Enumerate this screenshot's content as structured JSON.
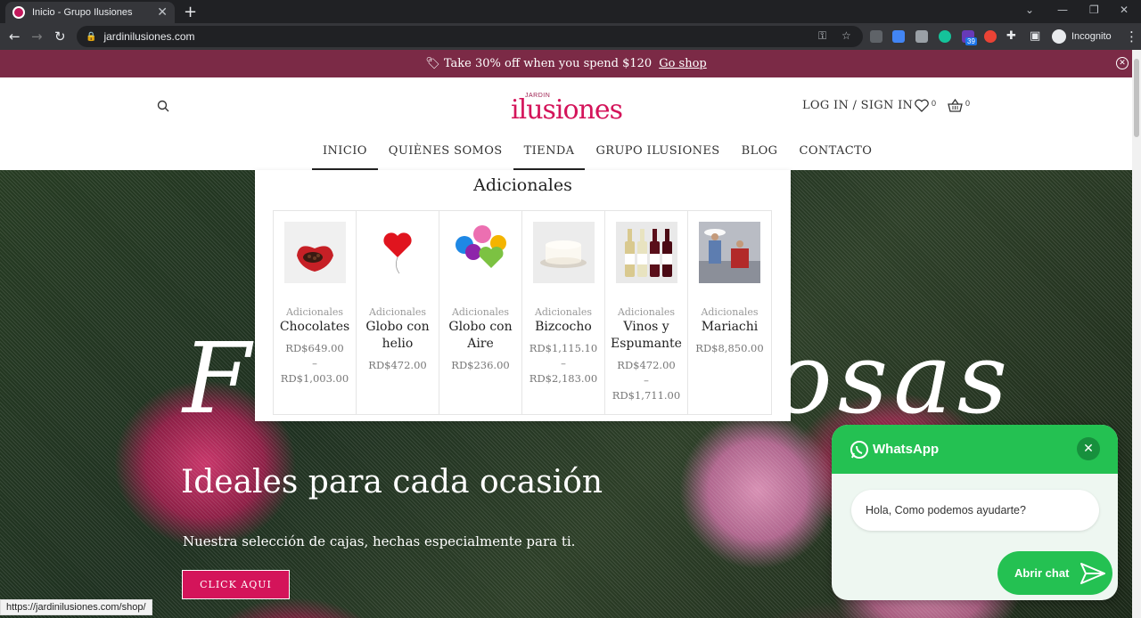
{
  "browser": {
    "tab_title": "Inicio - Grupo Ilusiones",
    "url": "jardinilusiones.com",
    "profile": "Incognito",
    "extension_badge": "39"
  },
  "promo": {
    "text": "🏷 Take 30% off when you spend $120",
    "link": "Go shop"
  },
  "header": {
    "logo_small": "JARDIN",
    "logo_big": "ilusiones",
    "login": "LOG IN / SIGN IN",
    "wishlist_count": "0",
    "cart_count": "0"
  },
  "nav": {
    "items": [
      {
        "label": "INICIO"
      },
      {
        "label": "QUIÈNES SOMOS"
      },
      {
        "label": "TIENDA"
      },
      {
        "label": "GRUPO ILUSIONES"
      },
      {
        "label": "BLOG"
      },
      {
        "label": "CONTACTO"
      }
    ]
  },
  "mega_menu": {
    "heading": "Adicionales",
    "products": [
      {
        "category": "Adicionales",
        "name_lines": [
          "Chocolates"
        ],
        "price_lines": [
          "RD$649.00",
          "–",
          "RD$1,003.00"
        ]
      },
      {
        "category": "Adicionales",
        "name_lines": [
          "Globo con",
          "helio"
        ],
        "price_lines": [
          "RD$472.00"
        ]
      },
      {
        "category": "Adicionales",
        "name_lines": [
          "Globo con",
          "Aire"
        ],
        "price_lines": [
          "RD$236.00"
        ]
      },
      {
        "category": "Adicionales",
        "name_lines": [
          "Bizcocho"
        ],
        "price_lines": [
          "RD$1,115.10",
          "–",
          "RD$2,183.00"
        ]
      },
      {
        "category": "Adicionales",
        "name_lines": [
          "Vinos y",
          "Espumante"
        ],
        "price_lines": [
          "RD$472.00",
          "–",
          "RD$1,711.00"
        ]
      },
      {
        "category": "Adicionales",
        "name_lines": [
          "Mariachi"
        ],
        "price_lines": [
          "RD$8,850.00"
        ]
      }
    ]
  },
  "hero": {
    "script": "Flores & Rosas",
    "title": "Ideales para cada ocasión",
    "subtitle": "Nuestra selección de cajas, hechas especialmente para ti.",
    "button": "CLICK AQUI"
  },
  "whatsapp": {
    "title": "WhatsApp",
    "message": "Hola, Como podemos ayudarte?",
    "button": "Abrir chat"
  },
  "status_url": "https://jardinilusiones.com/shop/",
  "colors": {
    "brand": "#d4145a",
    "promo_bg": "#7b2a46",
    "whatsapp": "#24c152"
  }
}
